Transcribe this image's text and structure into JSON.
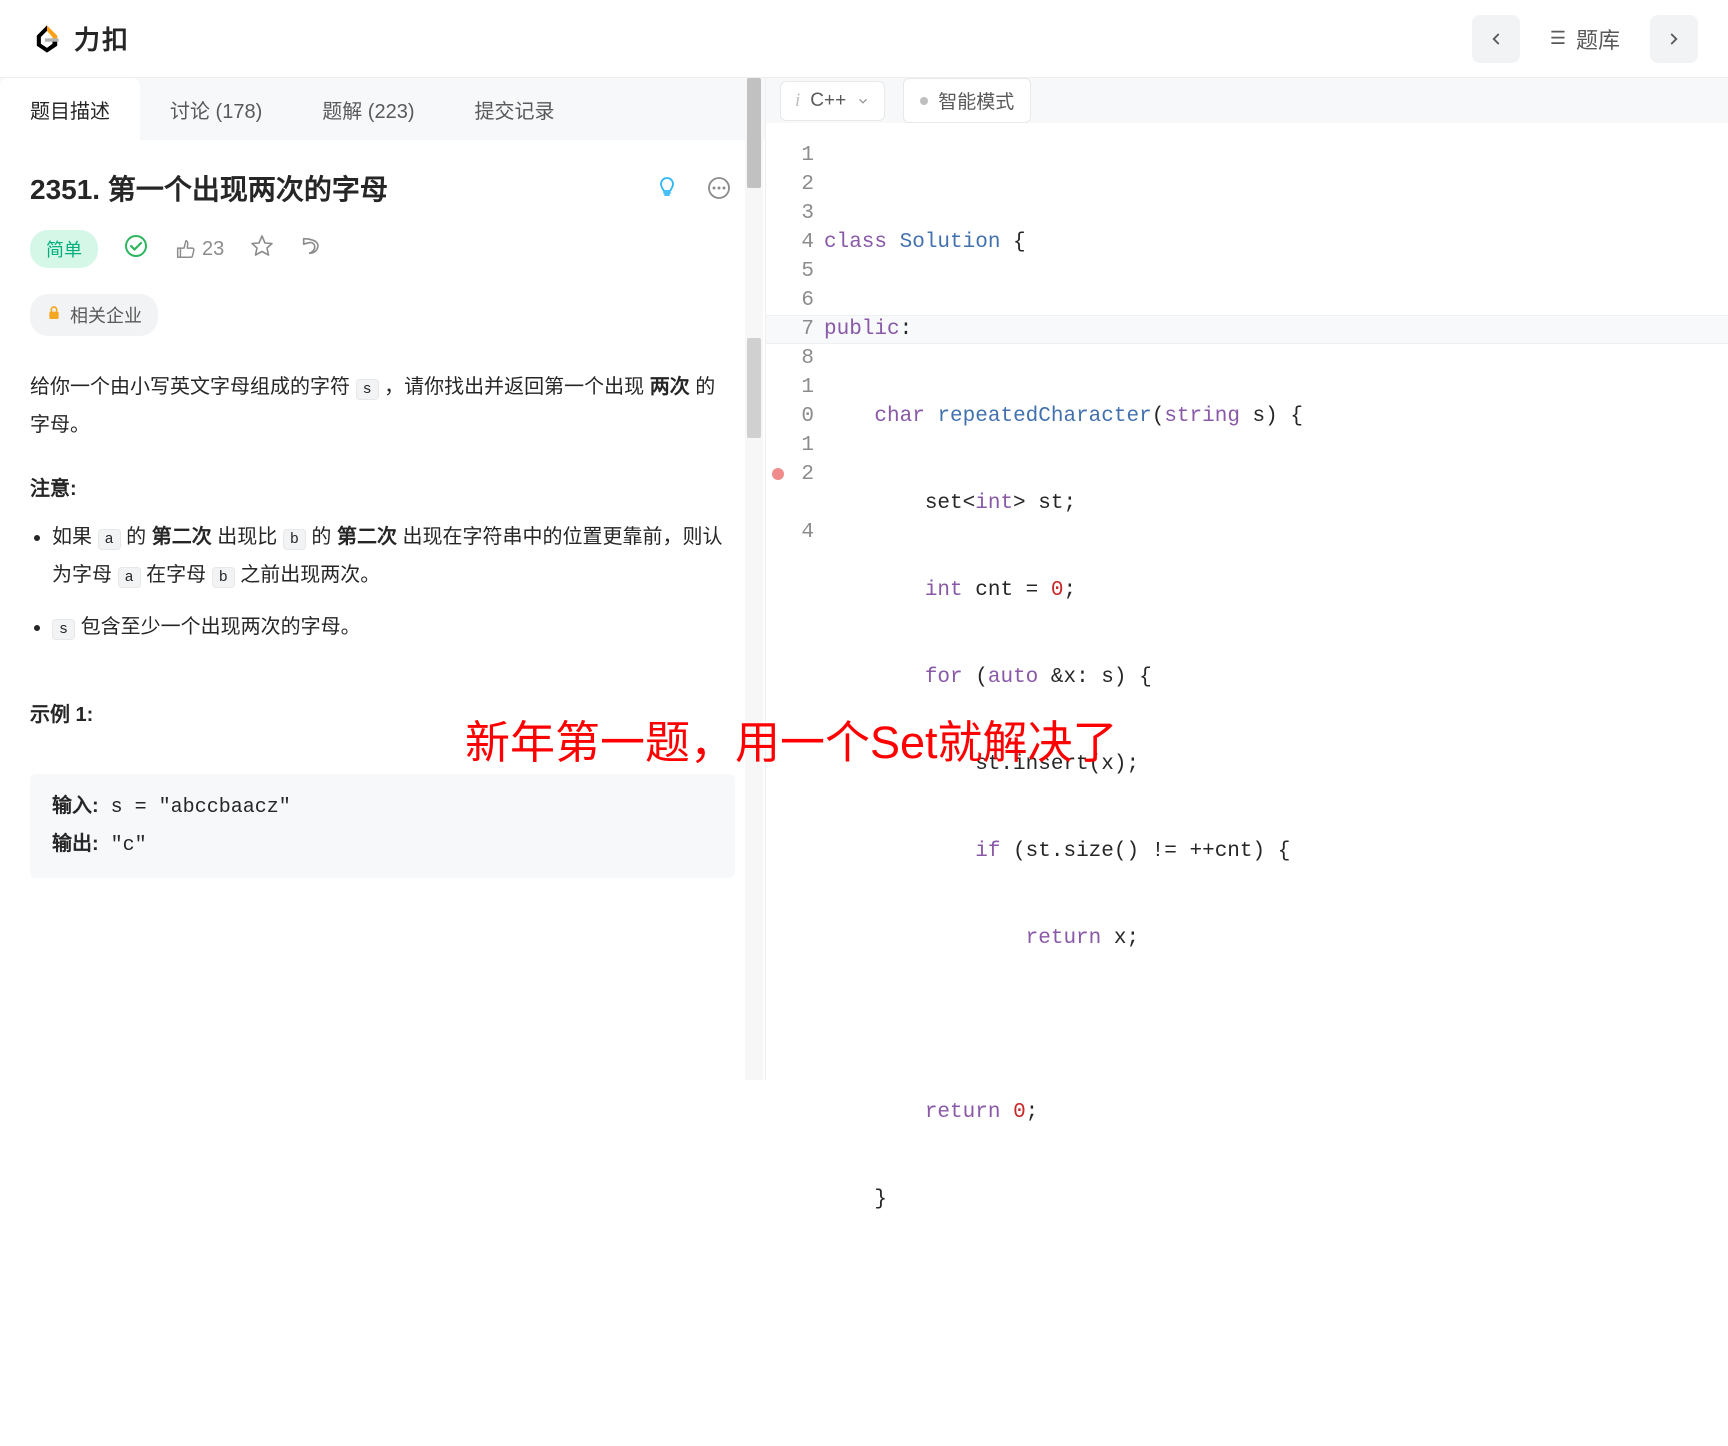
{
  "header": {
    "brand": "力扣",
    "lib_label": "题库"
  },
  "tabs": [
    {
      "label": "题目描述",
      "active": true
    },
    {
      "label": "讨论 (178)",
      "active": false
    },
    {
      "label": "题解 (223)",
      "active": false
    },
    {
      "label": "提交记录",
      "active": false
    }
  ],
  "problem": {
    "title": "2351. 第一个出现两次的字母",
    "difficulty": "简单",
    "likes": "23",
    "company_tag": "相关企业",
    "desc_p1_a": "给你一个由小写英文字母组成的字符 ",
    "desc_p1_code": "s",
    "desc_p1_b": " ，请你找出并返回第一个出现 ",
    "desc_p1_bold": "两次",
    "desc_p1_c": " 的字母。",
    "note_heading": "注意:",
    "li1_a": "如果 ",
    "li1_code1": "a",
    "li1_b": " 的 ",
    "li1_bold1": "第二次",
    "li1_c": " 出现比 ",
    "li1_code2": "b",
    "li1_d": " 的 ",
    "li1_bold2": "第二次",
    "li1_e": " 出现在字符串中的位置更靠前，则认为字母 ",
    "li1_code3": "a",
    "li1_f": " 在字母 ",
    "li1_code4": "b",
    "li1_g": " 之前出现两次。",
    "li2_code": "s",
    "li2_a": " 包含至少一个出现两次的字母。",
    "example_heading": "示例 1:",
    "example_in_label": "输入:",
    "example_in_val": " s = \"abccbaacz\"",
    "example_out_label": "输出:",
    "example_out_val": " \"c\""
  },
  "editor": {
    "lang": "C++",
    "mode": "智能模式",
    "gutter": [
      "1",
      "2",
      "3",
      "4",
      "5",
      "6",
      "7",
      "8",
      "1",
      "0",
      "1",
      "2",
      "",
      "4"
    ],
    "code": {
      "l1_a": "class",
      "l1_b": " Solution",
      "l1_c": " {",
      "l2_a": "public",
      "l2_b": ":",
      "l3_a": "    ",
      "l3_b": "char",
      "l3_c": " ",
      "l3_d": "repeatedCharacter",
      "l3_e": "(",
      "l3_f": "string",
      "l3_g": " s) {",
      "l4_a": "        set<",
      "l4_b": "int",
      "l4_c": "> st;",
      "l5_a": "        ",
      "l5_b": "int",
      "l5_c": " cnt = ",
      "l5_d": "0",
      "l5_e": ";",
      "l6_a": "        ",
      "l6_b": "for",
      "l6_c": " (",
      "l6_d": "auto",
      "l6_e": " &x: s) {",
      "l7_a": "            st.insert(x);",
      "l8_a": "            ",
      "l8_b": "if",
      "l8_c": " (st.size() != ++cnt) {",
      "l9_a": "                ",
      "l9_b": "return",
      "l9_c": " x;",
      "l10": "",
      "l11_a": "        ",
      "l11_b": "return",
      "l11_c": " ",
      "l11_d": "0",
      "l11_e": ";",
      "l12_a": "    }",
      "l13": "",
      "l14": ""
    }
  },
  "overlay": "新年第一题，用一个Set就解决了"
}
